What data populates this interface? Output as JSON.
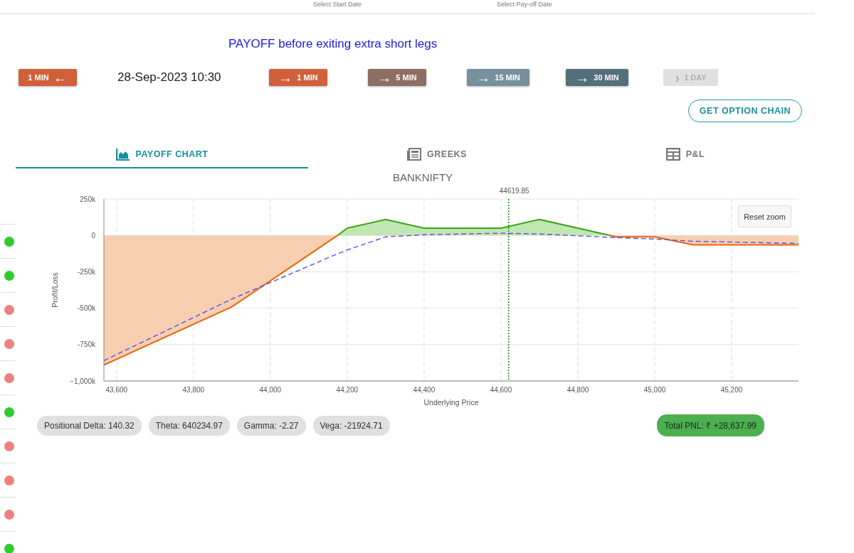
{
  "header": {
    "fields": [
      {
        "label": "Select Start Date"
      },
      {
        "label": "Select Pay-off Date"
      }
    ]
  },
  "sidebar": {
    "items": [
      {
        "color": "#2ecc2e"
      },
      {
        "color": "#2ecc2e"
      },
      {
        "color": "#f08080"
      },
      {
        "color": "#f08080"
      },
      {
        "color": "#f08080"
      },
      {
        "color": "#2ecc2e"
      },
      {
        "color": "#f08080"
      },
      {
        "color": "#f08080"
      },
      {
        "color": "#f08080"
      },
      {
        "color": "#2ecc2e"
      }
    ]
  },
  "heading": "PAYOFF before exiting extra short legs",
  "time_controls": [
    {
      "kind": "back",
      "label": "1 MIN",
      "icon": "←",
      "color": "#d0603a",
      "disabled": false
    },
    {
      "kind": "date",
      "label": "28-Sep-2023 10:30"
    },
    {
      "kind": "forward",
      "label": "1 MIN",
      "icon": "→",
      "color": "#d0603a",
      "disabled": false
    },
    {
      "kind": "forward",
      "label": "5 MIN",
      "icon": "→",
      "color": "#8d6e63",
      "disabled": false
    },
    {
      "kind": "forward",
      "label": "15 MIN",
      "icon": "→",
      "color": "#78909c",
      "disabled": false
    },
    {
      "kind": "forward",
      "label": "30 MIN",
      "icon": "→",
      "color": "#546e7a",
      "disabled": false
    },
    {
      "kind": "forward",
      "label": "1 DAY",
      "icon": "›",
      "color": "#e0e0e0",
      "disabled": true
    }
  ],
  "option_chain_button": "GET OPTION CHAIN",
  "tabs": [
    {
      "label": "PAYOFF CHART",
      "kind": "chart",
      "selected": true
    },
    {
      "label": "GREEKS",
      "kind": "greeks",
      "selected": false
    },
    {
      "label": "P&L",
      "kind": "table",
      "selected": false
    }
  ],
  "reset_zoom": "Reset zoom",
  "chart_data": {
    "type": "area",
    "title": "BANKNIFTY",
    "xlabel": "Underlying Price",
    "ylabel": "Profit/Loss",
    "xlim": [
      43567,
      45374
    ],
    "ylim": [
      -1000000,
      250000
    ],
    "xticks": [
      {
        "value": 43600,
        "label": "43,600"
      },
      {
        "value": 43800,
        "label": "43,800"
      },
      {
        "value": 44000,
        "label": "44,000"
      },
      {
        "value": 44200,
        "label": "44,200"
      },
      {
        "value": 44400,
        "label": "44,400"
      },
      {
        "value": 44600,
        "label": "44,600"
      },
      {
        "value": 44800,
        "label": "44,800"
      },
      {
        "value": 45000,
        "label": "45,000"
      },
      {
        "value": 45200,
        "label": "45,200"
      }
    ],
    "yticks": [
      {
        "value": 250000,
        "label": "250k"
      },
      {
        "value": 0,
        "label": "0"
      },
      {
        "value": -250000,
        "label": "-250k"
      },
      {
        "value": -500000,
        "label": "-500k"
      },
      {
        "value": -750000,
        "label": "-750k"
      },
      {
        "value": -1000000,
        "label": "−1,000k"
      }
    ],
    "x": [
      43567,
      43900,
      44175,
      44200,
      44300,
      44400,
      44600,
      44700,
      44900,
      45000,
      45100,
      45374
    ],
    "series": [
      {
        "type": "area",
        "color": "#e8650f",
        "values": [
          -890000,
          -490000,
          0,
          50000,
          110000,
          50000,
          50000,
          110000,
          -10000,
          -10000,
          -65000,
          -65000
        ]
      },
      {
        "type": "line",
        "line_style": "dashed",
        "color": "#5b4ee6",
        "values": [
          -860000,
          -437000,
          -126000,
          -100000,
          -10000,
          5000,
          15000,
          10000,
          -15000,
          -25000,
          -40000,
          -55000
        ]
      }
    ],
    "grid": true,
    "ref_lines": [
      {
        "axis": "x",
        "value": 44619.85,
        "label": "44619.85",
        "color": "#1a8a1a",
        "line_style": "dotted"
      }
    ]
  },
  "stats": [
    "Positional Delta: 140.32",
    "Theta: 640234.97",
    "Gamma: -2.27",
    "Vega: -21924.71"
  ],
  "total_pnl": "Total PNL: ₹ +28,637.99"
}
